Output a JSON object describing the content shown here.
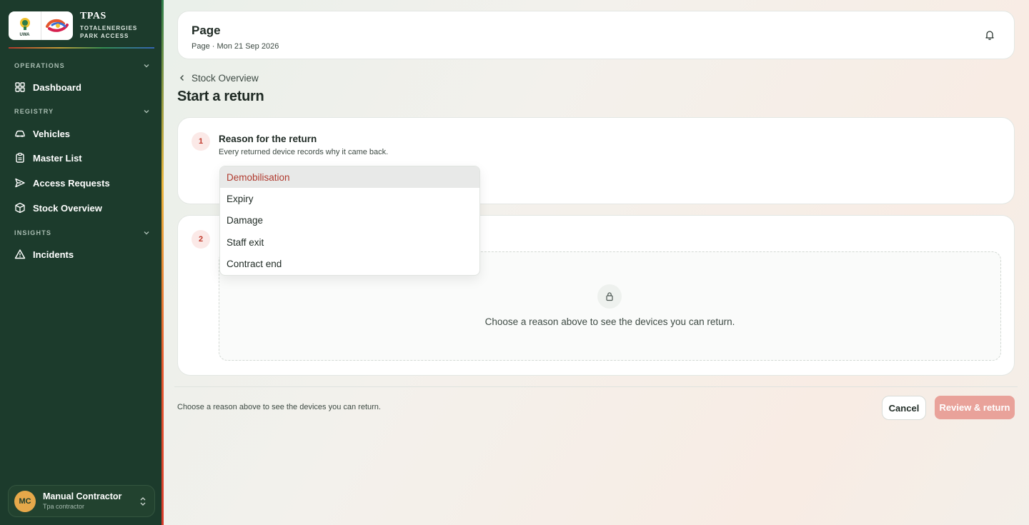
{
  "brand": {
    "title": "TPAS",
    "subtitle_line1": "TOTALENERGIES",
    "subtitle_line2": "PARK ACCESS",
    "uwa_label": "UWA"
  },
  "sidebar": {
    "sections": [
      {
        "label": "OPERATIONS",
        "items": [
          {
            "label": "Dashboard",
            "icon": "grid-icon"
          }
        ]
      },
      {
        "label": "REGISTRY",
        "items": [
          {
            "label": "Vehicles",
            "icon": "car-icon"
          },
          {
            "label": "Master List",
            "icon": "clipboard-icon"
          },
          {
            "label": "Access Requests",
            "icon": "send-icon"
          },
          {
            "label": "Stock Overview",
            "icon": "box-icon"
          }
        ]
      },
      {
        "label": "INSIGHTS",
        "items": [
          {
            "label": "Incidents",
            "icon": "warning-icon"
          }
        ]
      }
    ]
  },
  "user": {
    "initials": "MC",
    "name": "Manual Contractor",
    "role": "Tpa contractor"
  },
  "header": {
    "title": "Page",
    "subtitle": "Page · Mon 21 Sep 2026"
  },
  "breadcrumb": {
    "back_label": "Stock Overview"
  },
  "page": {
    "heading": "Start a return"
  },
  "step1": {
    "number": "1",
    "title": "Reason for the return",
    "description": "Every returned device records why it came back."
  },
  "step2": {
    "number": "2",
    "empty_message": "Choose a reason above to see the devices you can return."
  },
  "reason_dropdown": {
    "options": [
      "Demobilisation",
      "Expiry",
      "Damage",
      "Staff exit",
      "Contract end"
    ],
    "highlighted": "Demobilisation"
  },
  "footer": {
    "hint": "Choose a reason above to see the devices you can return.",
    "cancel_label": "Cancel",
    "review_label": "Review & return"
  },
  "colors": {
    "sidebar_bg": "#1c3b2c",
    "accent_red": "#c0392b",
    "review_button_disabled": "#e9a29a",
    "avatar_bg": "#e6a84a"
  }
}
